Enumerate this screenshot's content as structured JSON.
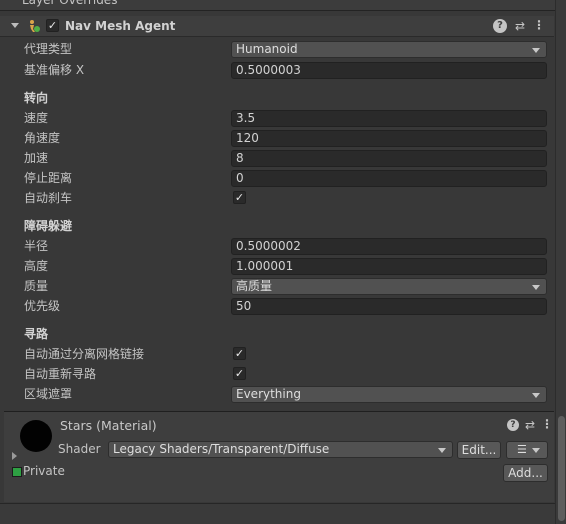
{
  "top_section": {
    "label": "Layer Overrides"
  },
  "component": {
    "title": "Nav Mesh Agent",
    "enabled": true,
    "help_icon": "help-icon",
    "settings_icon": "sliders-icon",
    "menu_icon": "kebab-menu-icon"
  },
  "agent": {
    "type_label": "代理类型",
    "type_value": "Humanoid",
    "offset_label": "基准偏移 X",
    "offset_value": "0.5000003"
  },
  "steering": {
    "header": "转向",
    "speed_label": "速度",
    "speed_value": "3.5",
    "angular_label": "角速度",
    "angular_value": "120",
    "accel_label": "加速",
    "accel_value": "8",
    "stop_label": "停止距离",
    "stop_value": "0",
    "brake_label": "自动刹车",
    "brake_checked": true
  },
  "avoidance": {
    "header": "障碍躲避",
    "radius_label": "半径",
    "radius_value": "0.5000002",
    "height_label": "高度",
    "height_value": "1.000001",
    "quality_label": "质量",
    "quality_value": "高质量",
    "priority_label": "优先级",
    "priority_value": "50"
  },
  "pathfinding": {
    "header": "寻路",
    "traverse_label": "自动通过分离网格链接",
    "traverse_checked": true,
    "repath_label": "自动重新寻路",
    "repath_checked": true,
    "area_label": "区域遮罩",
    "area_value": "Everything"
  },
  "material": {
    "title": "Stars (Material)",
    "shader_label": "Shader",
    "shader_value": "Legacy Shaders/Transparent/Diffuse",
    "edit_label": "Edit...",
    "private_label": "Private",
    "add_label": "Add..."
  }
}
